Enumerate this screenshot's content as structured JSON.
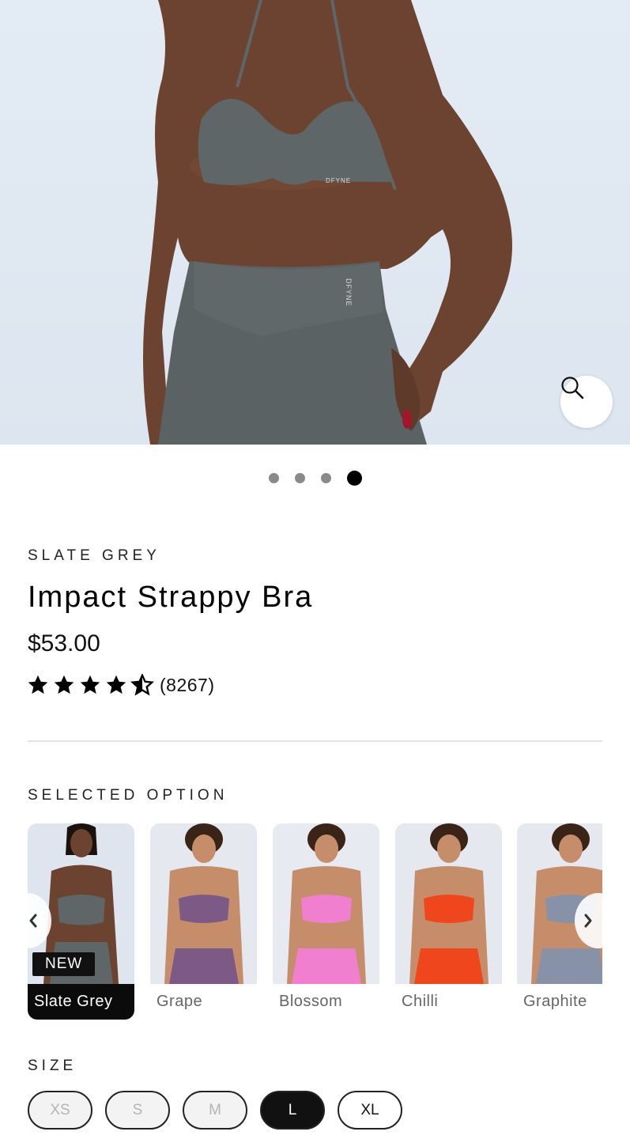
{
  "gallery": {
    "zoom_icon": "search-icon",
    "slide_count": 4,
    "active_slide": 4,
    "brand_mark": "DFYNE"
  },
  "product": {
    "color_name": "SLATE GREY",
    "title": "Impact Strappy Bra",
    "price": "$53.00",
    "rating_value": 4.5,
    "rating_max": 5,
    "rating_count": "(8267)"
  },
  "options": {
    "heading": "SELECTED OPTION",
    "new_badge": "NEW",
    "colors": [
      {
        "name": "Slate Grey",
        "selected": true,
        "fabric": "#5f6668",
        "bg": "#dfe5ee"
      },
      {
        "name": "Grape",
        "selected": false,
        "fabric": "#7d5a86",
        "bg": "#e6e8f0"
      },
      {
        "name": "Blossom",
        "selected": false,
        "fabric": "#f07fd0",
        "bg": "#e8eaf2"
      },
      {
        "name": "Chilli",
        "selected": false,
        "fabric": "#f0461e",
        "bg": "#e6e8f0"
      },
      {
        "name": "Graphite",
        "selected": false,
        "fabric": "#8791a8",
        "bg": "#e6e8f0"
      }
    ],
    "prev_icon": "chevron-left-icon",
    "next_icon": "chevron-right-icon"
  },
  "size": {
    "heading": "SIZE",
    "options": [
      {
        "label": "XS",
        "state": "unavailable"
      },
      {
        "label": "S",
        "state": "unavailable"
      },
      {
        "label": "M",
        "state": "unavailable"
      },
      {
        "label": "L",
        "state": "selected"
      },
      {
        "label": "XL",
        "state": "available"
      }
    ]
  },
  "colors": {
    "skin": "#6b4330",
    "fabric": "#5f6668",
    "backdrop": "#e1e9f2",
    "accent": "#000000"
  }
}
